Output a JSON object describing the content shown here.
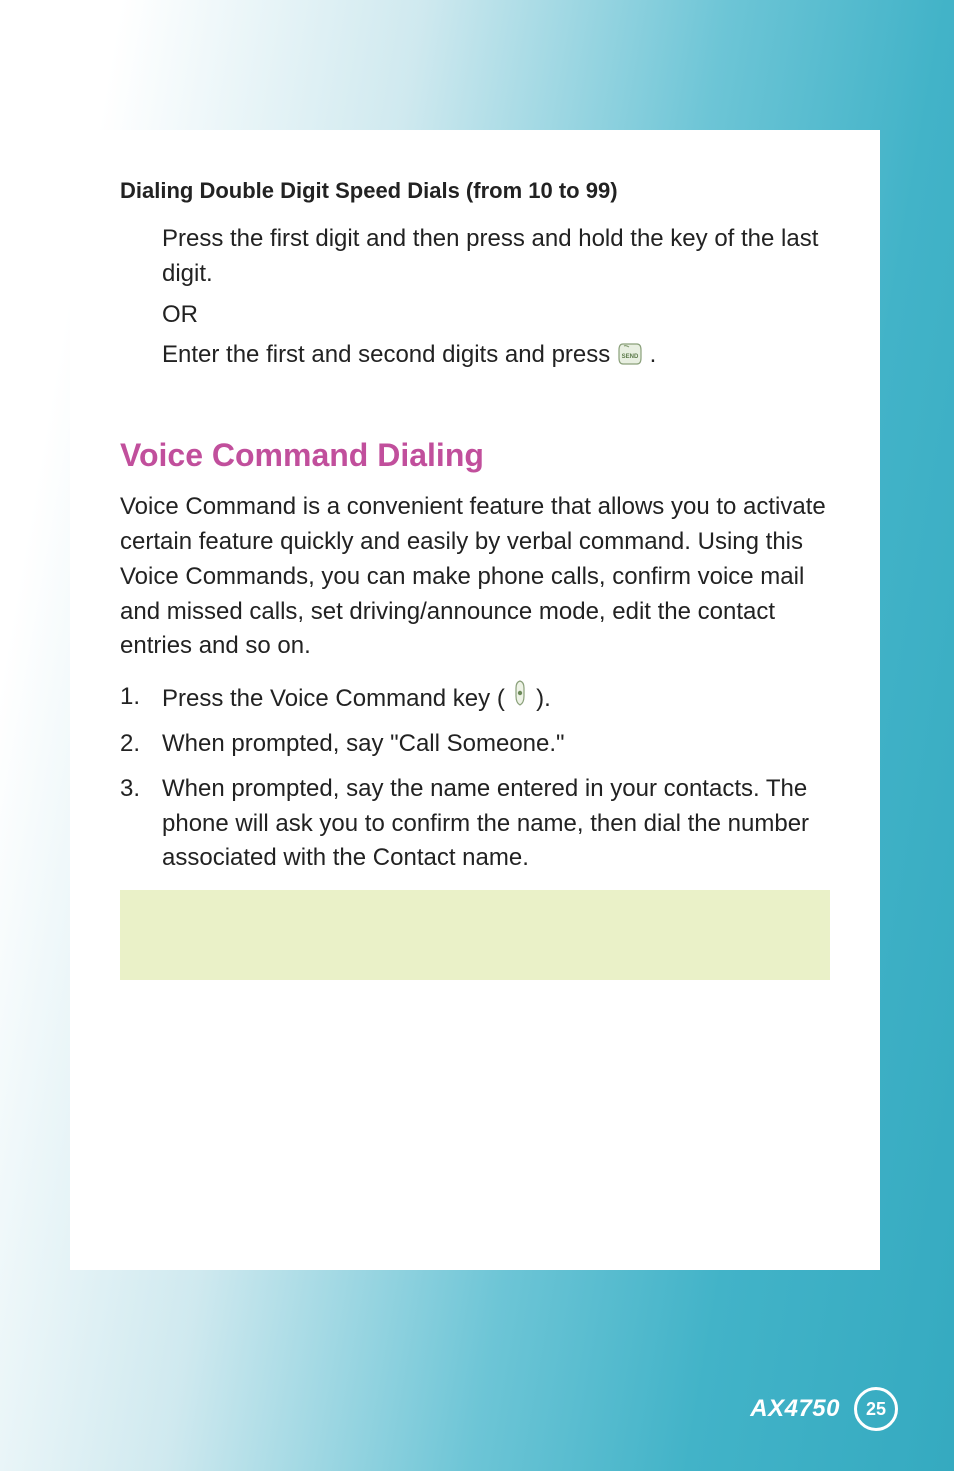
{
  "section1": {
    "heading": "Dialing Double Digit Speed Dials (from 10 to 99)",
    "line1": "Press the first digit and then press and hold the key of the last digit.",
    "or": "OR",
    "line2a": "Enter the first and second digits and press ",
    "line2b": "."
  },
  "section2": {
    "title": "Voice Command Dialing",
    "intro": "Voice Command is a convenient feature that allows you to activate certain feature quickly and easily by verbal command. Using this Voice Commands, you can make phone calls, confirm voice mail and missed calls, set driving/announce mode, edit the contact entries and so on.",
    "steps": [
      {
        "num": "1.",
        "pre": "Press the Voice Command key ( ",
        "post": " )."
      },
      {
        "num": "2.",
        "text": "When prompted, say \"Call Someone.\""
      },
      {
        "num": "3.",
        "text": "When prompted, say the name entered in your contacts. The phone will ask you to confirm the name, then dial the number associated with the Contact name."
      }
    ]
  },
  "footer": {
    "model": "AX4750",
    "page": "25"
  },
  "icons": {
    "send": "send-key-icon",
    "voice": "voice-command-key-icon"
  }
}
